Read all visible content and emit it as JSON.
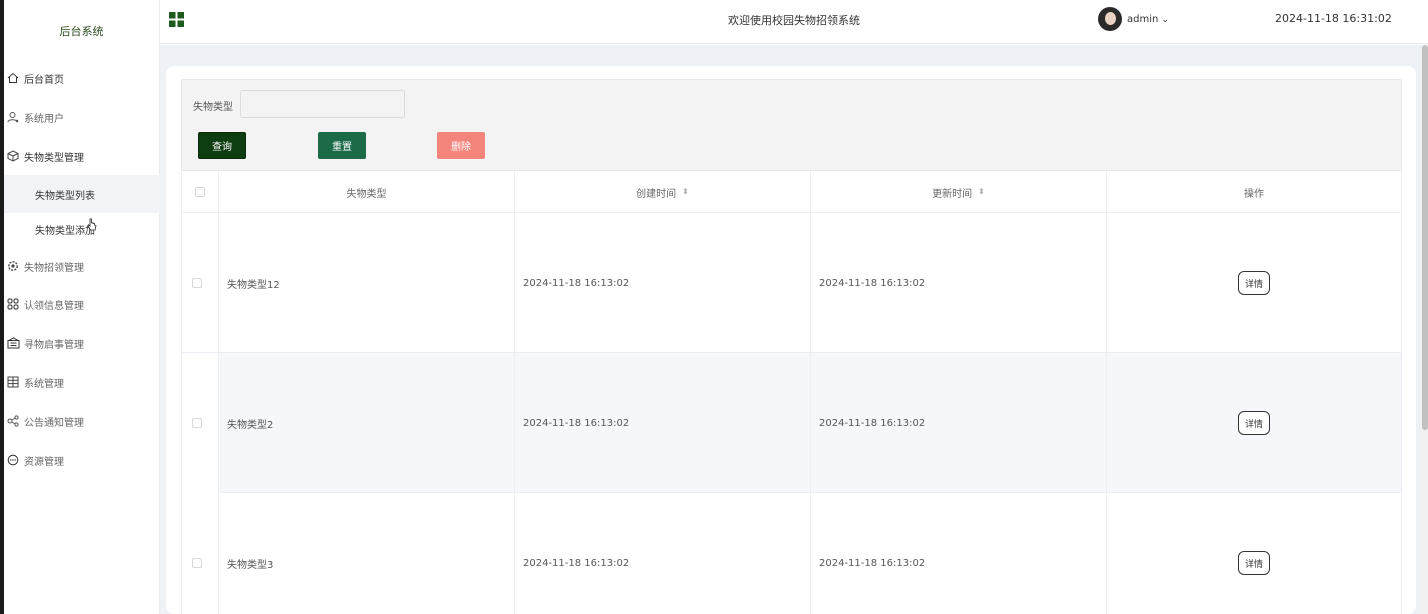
{
  "sidebar": {
    "logo": "后台系统",
    "items": [
      {
        "label": "后台首页",
        "icon": "home-icon"
      },
      {
        "label": "系统用户",
        "icon": "user-icon"
      },
      {
        "label": "失物类型管理",
        "icon": "cube-icon"
      },
      {
        "label": "失物类型列表"
      },
      {
        "label": "失物类型添加"
      },
      {
        "label": "失物招领管理",
        "icon": "gear-icon"
      },
      {
        "label": "认领信息管理",
        "icon": "apps-icon"
      },
      {
        "label": "寻物启事管理",
        "icon": "notice-board-icon"
      },
      {
        "label": "系统管理",
        "icon": "grid-icon"
      },
      {
        "label": "公告通知管理",
        "icon": "share-icon"
      },
      {
        "label": "资源管理",
        "icon": "chat-icon"
      }
    ]
  },
  "header": {
    "title": "欢迎使用校园失物招领系统",
    "user": "admin",
    "datetime": "2024-11-18 16:31:02"
  },
  "filter": {
    "label": "失物类型",
    "value": "",
    "query_label": "查询",
    "reset_label": "重置",
    "delete_label": "删除"
  },
  "table": {
    "columns": [
      "失物类型",
      "创建时间",
      "更新时间",
      "操作"
    ],
    "rows": [
      {
        "type": "失物类型12",
        "created": "2024-11-18 16:13:02",
        "updated": "2024-11-18 16:13:02",
        "action": "详情"
      },
      {
        "type": "失物类型2",
        "created": "2024-11-18 16:13:02",
        "updated": "2024-11-18 16:13:02",
        "action": "详情"
      },
      {
        "type": "失物类型3",
        "created": "2024-11-18 16:13:02",
        "updated": "2024-11-18 16:13:02",
        "action": "详情"
      }
    ]
  },
  "colors": {
    "brand_dark_green": "#0f3d12",
    "reset_green": "#1d6a48",
    "delete_red": "#f3857c",
    "content_bg": "#eef1f6"
  }
}
